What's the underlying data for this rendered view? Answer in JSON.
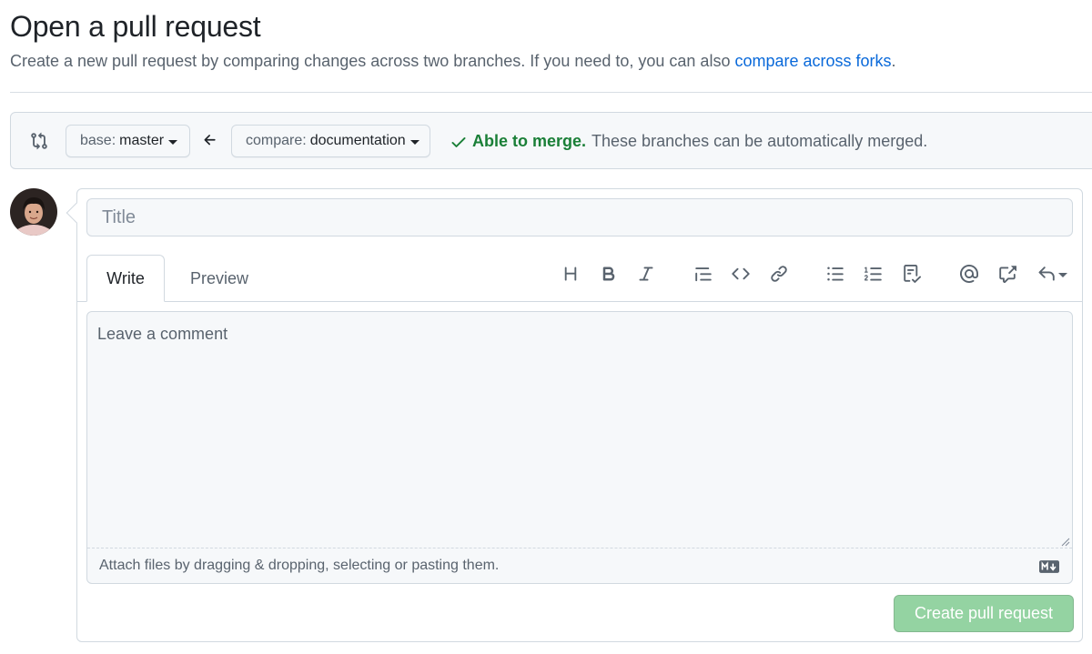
{
  "header": {
    "title": "Open a pull request",
    "subtitle": "Create a new pull request by comparing changes across two branches. If you need to, you can also ",
    "subtitle_link": "compare across forks",
    "subtitle_end": "."
  },
  "compare": {
    "icon": "git-compare-icon",
    "base_label": "base:",
    "base_value": "master",
    "arrow_icon": "arrow-left-icon",
    "compare_label": "compare:",
    "compare_value": "documentation",
    "status_ok": "Able to merge.",
    "status_desc": "These branches can be automatically merged.",
    "status_color": "#1a7f37"
  },
  "form": {
    "title_placeholder": "Title",
    "tabs": [
      {
        "label": "Write",
        "active": true
      },
      {
        "label": "Preview",
        "active": false
      }
    ],
    "toolbar": [
      "heading-icon",
      "bold-icon",
      "italic-icon",
      "quote-icon",
      "code-icon",
      "link-icon",
      "unordered-list-icon",
      "ordered-list-icon",
      "task-list-icon",
      "mention-icon",
      "cross-reference-icon",
      "saved-replies-icon"
    ],
    "comment_placeholder": "Leave a comment",
    "attach_text": "Attach files by dragging & dropping, selecting or pasting them.",
    "markdown_icon": "markdown-icon",
    "submit_label": "Create pull request",
    "submit_color": "#94d3a2"
  }
}
